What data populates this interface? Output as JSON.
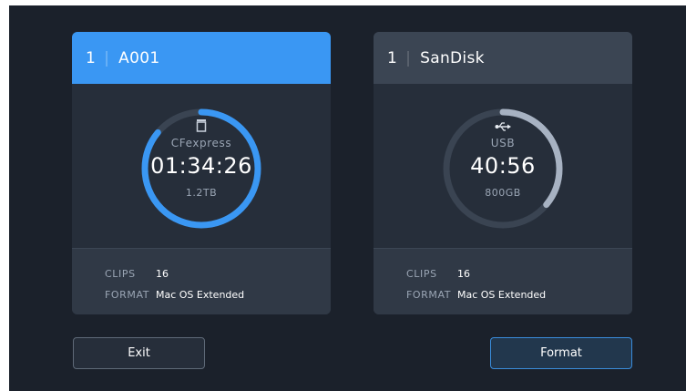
{
  "slots": [
    {
      "slot": "1",
      "name": "A001",
      "media_type": "CFexpress",
      "media_icon": "cfexpress-card-icon",
      "remaining": "01:34:26",
      "capacity": "1.2TB",
      "used_fraction": 0.86,
      "ring_color": "#3a97f3",
      "active": true,
      "clips_label": "CLIPS",
      "clips": "16",
      "format_label": "FORMAT",
      "format": "Mac OS Extended"
    },
    {
      "slot": "1",
      "name": "SanDisk",
      "media_type": "USB",
      "media_icon": "usb-icon",
      "remaining": "40:56",
      "capacity": "800GB",
      "used_fraction": 0.36,
      "ring_color": "#a7b2c2",
      "active": false,
      "clips_label": "CLIPS",
      "clips": "16",
      "format_label": "FORMAT",
      "format": "Mac OS Extended"
    }
  ],
  "buttons": {
    "exit": "Exit",
    "format": "Format"
  },
  "colors": {
    "background": "#1b212b",
    "card": "#303946",
    "accent": "#3a97f3"
  }
}
